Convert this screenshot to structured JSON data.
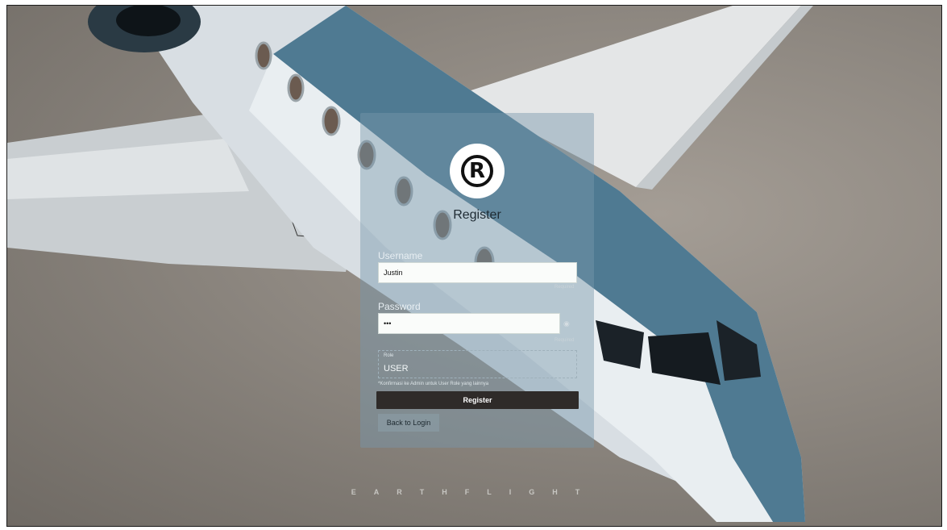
{
  "form": {
    "title": "Register",
    "username_label": "Username",
    "username_value": "Justin",
    "username_required": "Required",
    "password_label": "Password",
    "password_value": "•••",
    "password_required": "Required",
    "role_label": "Role",
    "role_value": "USER",
    "role_hint": "*Konfirmasi ke Admin untuk User Role yang lainnya",
    "register_button": "Register",
    "back_button": "Back to Login"
  },
  "logo": {
    "symbol": "R",
    "icon": "registered-trademark-icon"
  },
  "brand": {
    "text": "EARTHFLIGHT"
  },
  "colors": {
    "button": "#2f2b29",
    "panel": "rgba(120,150,170,0.45)"
  }
}
